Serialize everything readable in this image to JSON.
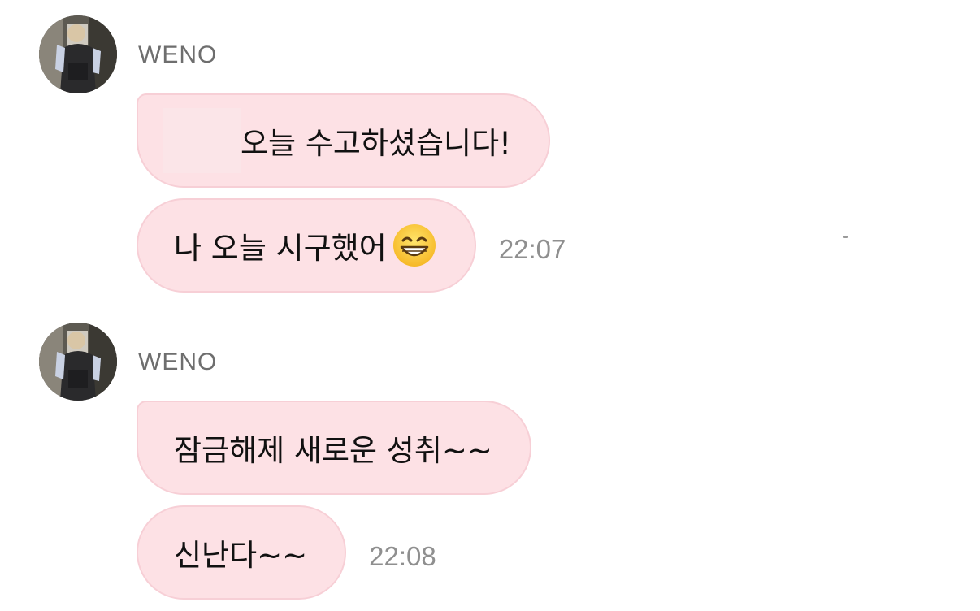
{
  "messages": [
    {
      "sender": "WENO",
      "bubbles": [
        {
          "text": "오늘 수고하셨습니다!"
        },
        {
          "text": "나 오늘 시구했어",
          "emoji": "grinning-face-with-smiling-eyes-emoji"
        }
      ],
      "time": "22:07"
    },
    {
      "sender": "WENO",
      "bubbles": [
        {
          "text": "잠금해제 새로운 성취~~"
        },
        {
          "text": "신난다~~"
        }
      ],
      "time": "22:08"
    }
  ],
  "colors": {
    "bubble_bg": "#fde1e5",
    "bubble_border": "#f7cfd6",
    "sender_text": "#6e6e6e",
    "time_text": "#8f8f8f",
    "message_text": "#111111"
  }
}
